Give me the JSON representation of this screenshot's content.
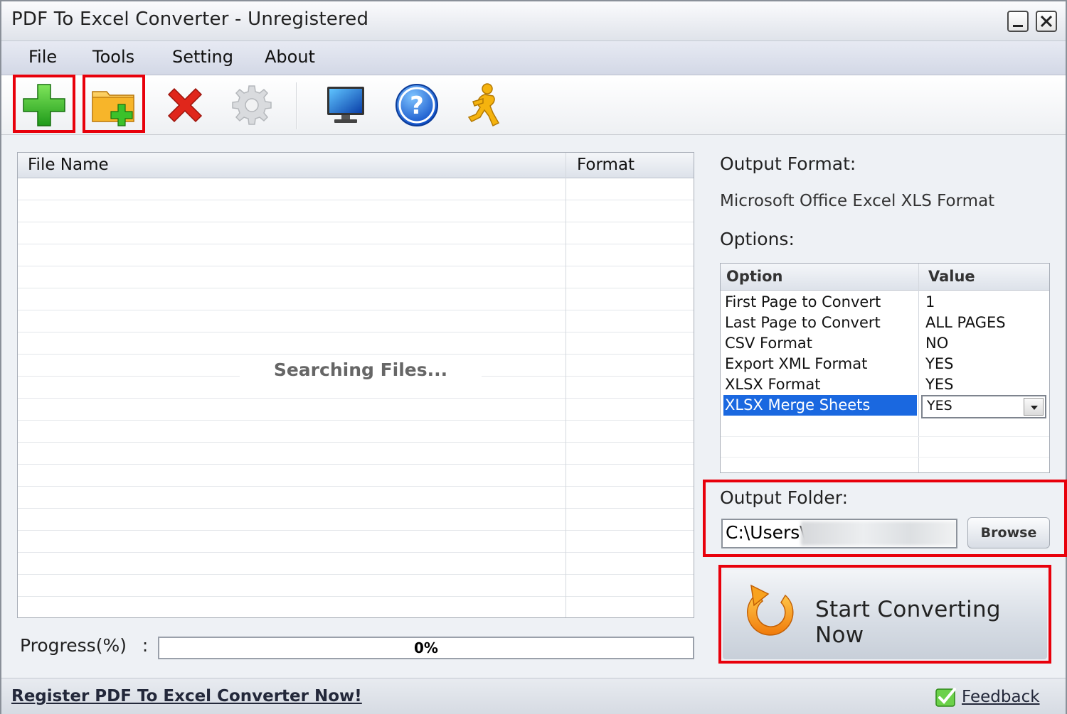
{
  "window": {
    "title": "PDF To Excel Converter - Unregistered"
  },
  "menu": {
    "items": [
      "File",
      "Tools",
      "Setting",
      "About"
    ]
  },
  "toolbar": {
    "buttons": [
      "add-file-icon",
      "add-folder-icon",
      "delete-icon",
      "settings-gear-icon",
      "monitor-icon",
      "help-icon",
      "runner-icon"
    ]
  },
  "file_list": {
    "columns": [
      "File Name",
      "Format"
    ],
    "status_text": "Searching Files..."
  },
  "progress": {
    "label": "Progress(%)",
    "separator": ":",
    "value_text": "0%",
    "value": 0
  },
  "output_format": {
    "label": "Output Format:",
    "value": "Microsoft Office Excel XLS Format"
  },
  "options": {
    "label": "Options:",
    "columns": [
      "Option",
      "Value"
    ],
    "rows": [
      {
        "name": "First Page to Convert",
        "value": "1"
      },
      {
        "name": "Last Page to Convert",
        "value": "ALL PAGES"
      },
      {
        "name": "CSV Format",
        "value": "NO"
      },
      {
        "name": "Export XML Format",
        "value": "YES"
      },
      {
        "name": "XLSX Format",
        "value": "YES"
      },
      {
        "name": "XLSX Merge Sheets",
        "value": "YES",
        "selected": true
      }
    ]
  },
  "output_folder": {
    "label": "Output Folder:",
    "value": "C:\\Users\\",
    "browse_label": "Browse"
  },
  "start_button": {
    "label": "Start Converting Now"
  },
  "statusbar": {
    "register_link": "Register PDF To Excel Converter Now!",
    "feedback_link": "Feedback"
  },
  "colors": {
    "highlight": "#e8000b",
    "selection": "#1a68e0"
  }
}
